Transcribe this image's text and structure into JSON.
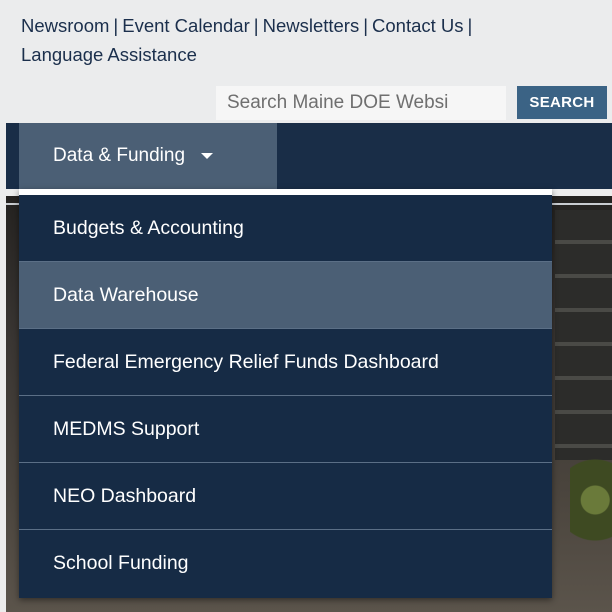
{
  "utility_nav": {
    "links": [
      "Newsroom",
      "Event Calendar",
      "Newsletters",
      "Contact Us",
      "Language Assistance"
    ],
    "separator": "|"
  },
  "search": {
    "placeholder": "Search Maine DOE Websi",
    "button_label": "SEARCH"
  },
  "main_nav": {
    "active_tab_label": "Data & Funding",
    "active_tab_icon": "caret-down-icon"
  },
  "dropdown": {
    "items": [
      {
        "label": "Budgets & Accounting",
        "active": false
      },
      {
        "label": "Data Warehouse",
        "active": true
      },
      {
        "label": "Federal Emergency Relief Funds Dashboard",
        "active": false
      },
      {
        "label": "MEDMS Support",
        "active": false
      },
      {
        "label": "NEO Dashboard",
        "active": false
      },
      {
        "label": "School Funding",
        "active": false
      }
    ]
  },
  "colors": {
    "navbar": "#192d47",
    "active_tab": "#4b5f75",
    "dropdown": "#162b45",
    "search_button": "#3b6385",
    "link_text": "#1b2f4c"
  }
}
